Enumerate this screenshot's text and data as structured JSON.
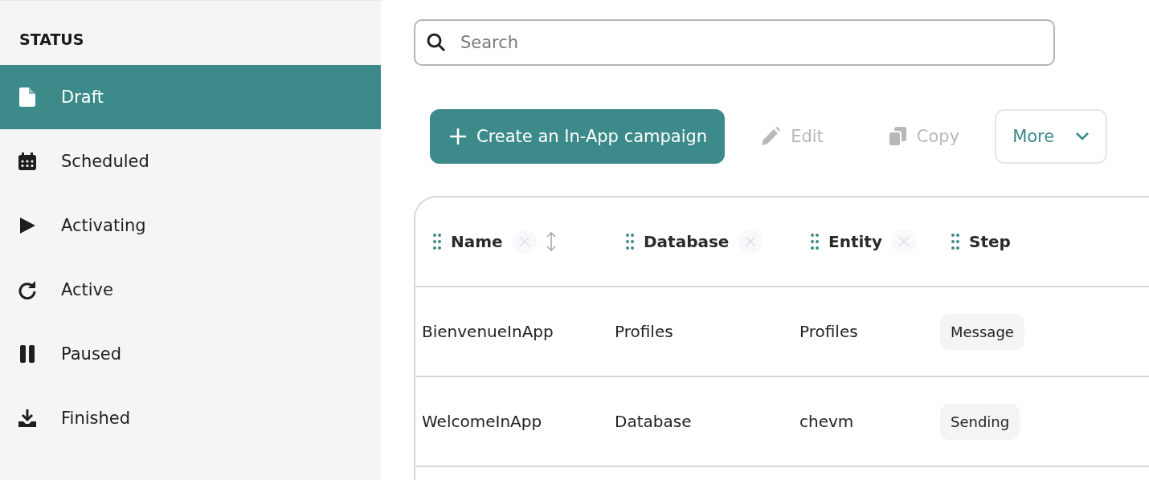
{
  "sidebar": {
    "heading": "STATUS",
    "items": [
      {
        "label": "Draft",
        "selected": true
      },
      {
        "label": "Scheduled",
        "selected": false
      },
      {
        "label": "Activating",
        "selected": false
      },
      {
        "label": "Active",
        "selected": false
      },
      {
        "label": "Paused",
        "selected": false
      },
      {
        "label": "Finished",
        "selected": false
      }
    ]
  },
  "search": {
    "placeholder": "Search"
  },
  "toolbar": [
    {
      "kind": "primary",
      "label": "Create an In-App campaign",
      "disabled": false
    },
    {
      "kind": "edit",
      "label": "Edit",
      "disabled": true
    },
    {
      "kind": "copy",
      "label": "Copy",
      "disabled": true
    },
    {
      "kind": "menu",
      "label": "More",
      "disabled": false
    }
  ],
  "table": {
    "columns": [
      {
        "label": "Name",
        "removable": true,
        "sortable": true,
        "kind": "text"
      },
      {
        "label": "Database",
        "removable": true,
        "sortable": false,
        "kind": "text"
      },
      {
        "label": "Entity",
        "removable": true,
        "sortable": false,
        "kind": "text"
      },
      {
        "label": "Step",
        "removable": false,
        "sortable": false,
        "kind": "tag"
      }
    ],
    "rows": [
      [
        "BienvenueInApp",
        "Profiles",
        "Profiles",
        "Message"
      ],
      [
        "WelcomeInApp",
        "Database",
        "chevm",
        "Sending"
      ]
    ]
  }
}
